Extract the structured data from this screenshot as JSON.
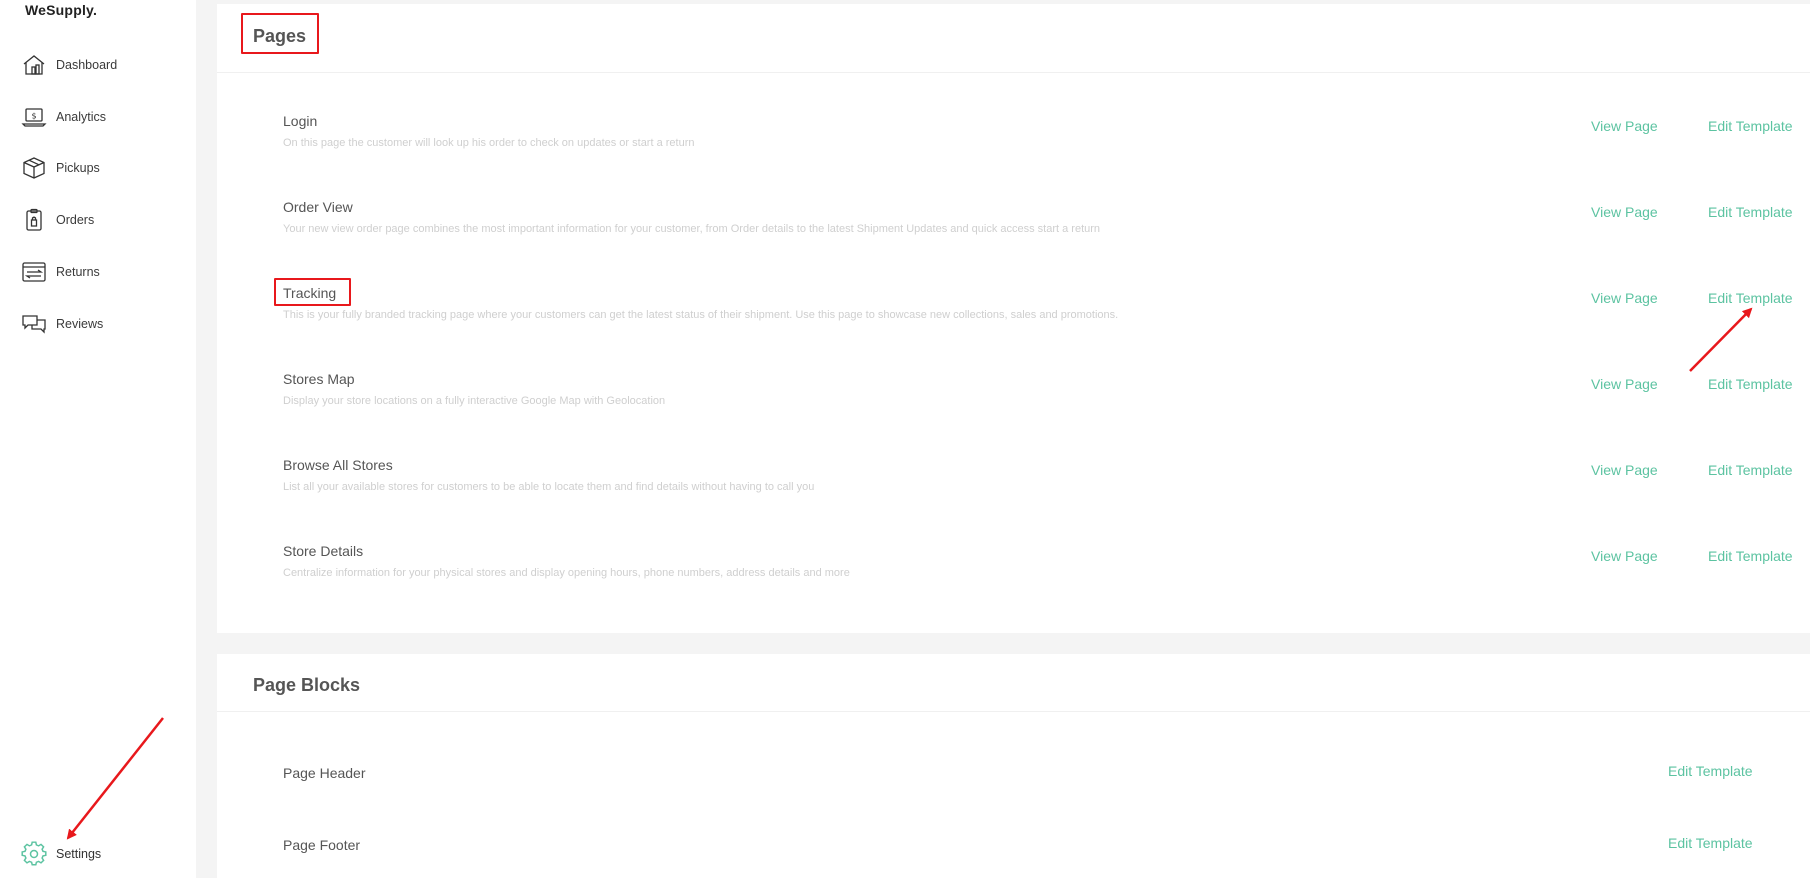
{
  "brand": "WeSupply.",
  "sidebar": {
    "items": [
      {
        "label": "Dashboard",
        "icon": "dashboard-icon"
      },
      {
        "label": "Analytics",
        "icon": "analytics-icon"
      },
      {
        "label": "Pickups",
        "icon": "pickups-box-icon"
      },
      {
        "label": "Orders",
        "icon": "orders-icon"
      },
      {
        "label": "Returns",
        "icon": "returns-icon"
      },
      {
        "label": "Reviews",
        "icon": "reviews-icon"
      }
    ],
    "settings": {
      "label": "Settings",
      "icon": "gear-icon"
    }
  },
  "pages": {
    "title": "Pages",
    "rows": [
      {
        "name": "Login",
        "description": "On this page the customer will look up his order to check on updates or start a return",
        "view_label": "View Page",
        "edit_label": "Edit Template"
      },
      {
        "name": "Order View",
        "description": "Your new view order page combines the most important information for your customer, from Order details to the latest Shipment Updates and quick access start a return",
        "view_label": "View Page",
        "edit_label": "Edit Template"
      },
      {
        "name": "Tracking",
        "description": "This is your fully branded tracking page where your customers can get the latest status of their shipment. Use this page to showcase new collections, sales and promotions.",
        "view_label": "View Page",
        "edit_label": "Edit Template"
      },
      {
        "name": "Stores Map",
        "description": "Display your store locations on a fully interactive Google Map with Geolocation",
        "view_label": "View Page",
        "edit_label": "Edit Template"
      },
      {
        "name": "Browse All Stores",
        "description": "List all your available stores for customers to be able to locate them and find details without having to call you",
        "view_label": "View Page",
        "edit_label": "Edit Template"
      },
      {
        "name": "Store Details",
        "description": "Centralize information for your physical stores and display opening hours, phone numbers, address details and more",
        "view_label": "View Page",
        "edit_label": "Edit Template"
      }
    ]
  },
  "page_blocks": {
    "title": "Page Blocks",
    "rows": [
      {
        "name": "Page Header",
        "edit_label": "Edit Template"
      },
      {
        "name": "Page Footer",
        "edit_label": "Edit Template"
      }
    ]
  },
  "colors": {
    "accent": "#5cc3a1",
    "annotation": "#e8181c",
    "background": "#f4f4f4"
  }
}
